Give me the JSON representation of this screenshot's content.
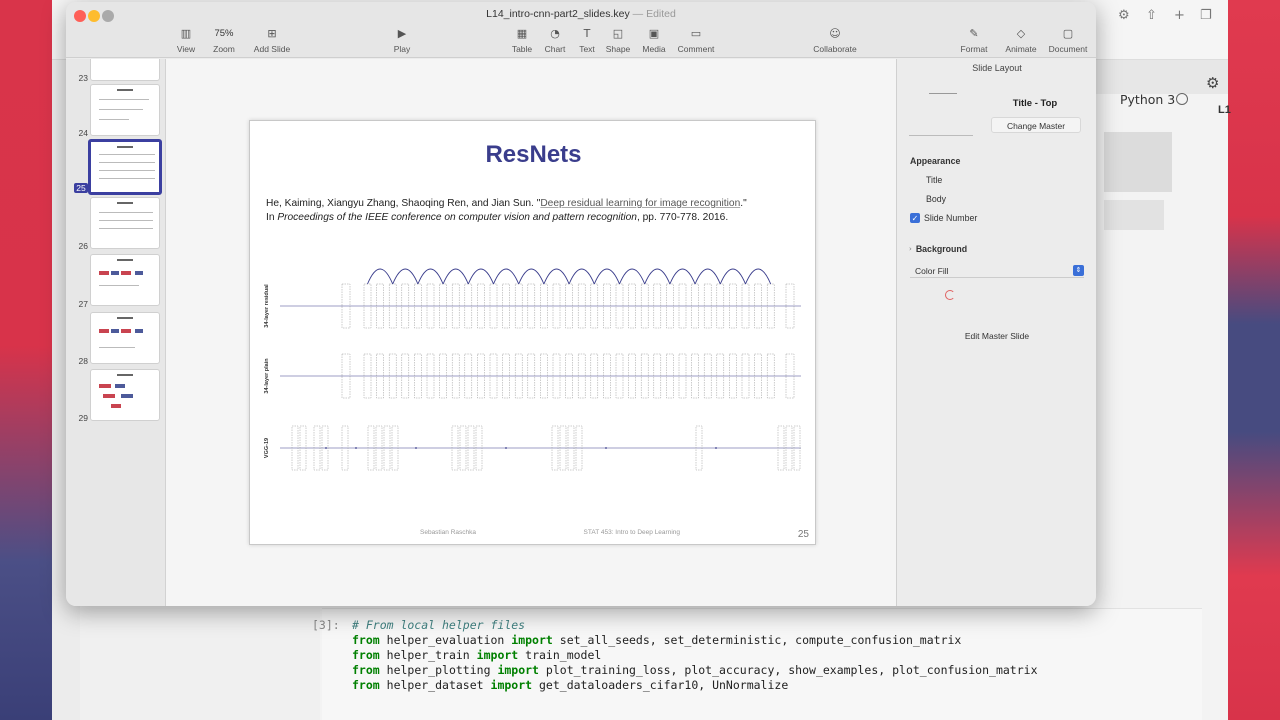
{
  "background_app": {
    "kernel_label": "Python 3",
    "tab_label": "L1",
    "cell_prompt": "[3]:",
    "code_lines": [
      {
        "type": "comment",
        "text": "# From local helper files"
      },
      {
        "type": "import",
        "kw1": "from",
        "module": "helper_evaluation",
        "kw2": "import",
        "names": "set_all_seeds, set_deterministic, compute_confusion_matrix"
      },
      {
        "type": "import",
        "kw1": "from",
        "module": "helper_train",
        "kw2": "import",
        "names": "train_model"
      },
      {
        "type": "import",
        "kw1": "from",
        "module": "helper_plotting",
        "kw2": "import",
        "names": "plot_training_loss, plot_accuracy, show_examples, plot_confusion_matrix"
      },
      {
        "type": "import",
        "kw1": "from",
        "module": "helper_dataset",
        "kw2": "import",
        "names": "get_dataloaders_cifar10, UnNormalize"
      }
    ]
  },
  "window": {
    "title": "L14_intro-cnn-part2_slides.key",
    "status": "— Edited"
  },
  "toolbar": {
    "view": "View",
    "zoom_value": "75%",
    "zoom": "Zoom",
    "add_slide": "Add Slide",
    "play": "Play",
    "table": "Table",
    "chart": "Chart",
    "text": "Text",
    "shape": "Shape",
    "media": "Media",
    "comment": "Comment",
    "collaborate": "Collaborate",
    "format": "Format",
    "animate": "Animate",
    "document": "Document"
  },
  "navigator": {
    "slide_numbers": [
      "23",
      "24",
      "25",
      "26",
      "27",
      "28",
      "29"
    ],
    "selected": "25"
  },
  "slide": {
    "title": "ResNets",
    "citation_authors": "He, Kaiming, Xiangyu Zhang, Shaoqing Ren, and Jian Sun. \"",
    "citation_link": "Deep residual learning for image recognition",
    "citation_end": ".\"",
    "citation_in": "In ",
    "citation_venue": "Proceedings of the IEEE conference on computer vision and pattern recognition",
    "citation_pages": ", pp. 770-778. 2016.",
    "row_labels": [
      "34-layer residual",
      "34-layer plain",
      "VGG-19"
    ],
    "footer_left": "Sebastian Raschka",
    "footer_right": "STAT 453: Intro to Deep Learning",
    "number": "25"
  },
  "inspector": {
    "heading": "Slide Layout",
    "master_name": "Title - Top",
    "change_master": "Change Master",
    "appearance": "Appearance",
    "title_option": "Title",
    "body_option": "Body",
    "slide_number_option": "Slide Number",
    "background": "Background",
    "fill_value": "Color Fill",
    "edit_master": "Edit Master Slide"
  },
  "colors": {
    "slide_title": "#3a3d8c",
    "selection": "#3b3fa0",
    "checkbox": "#3a6fd8"
  }
}
